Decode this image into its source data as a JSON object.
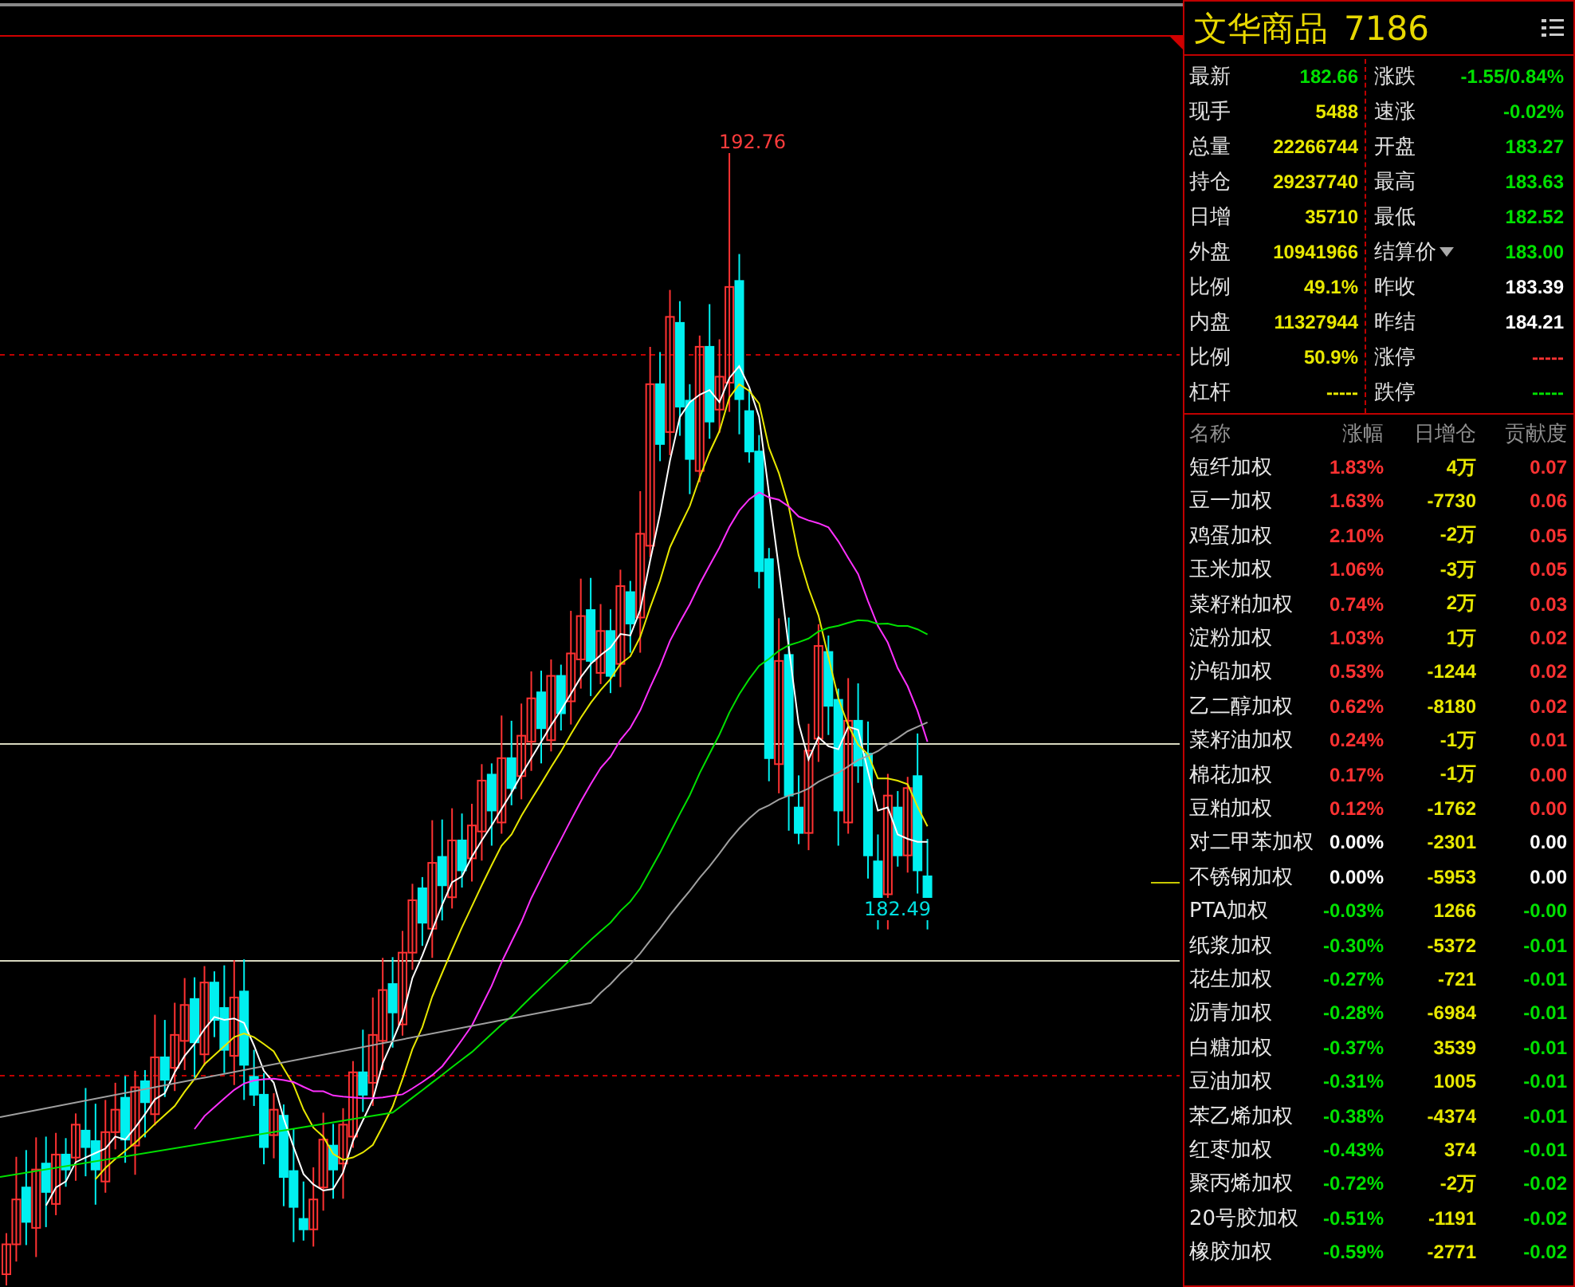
{
  "chart": {
    "high_label": "192.76",
    "low_label": "182.49"
  },
  "instrument": {
    "name": "文华商品",
    "code": "7186"
  },
  "quote": {
    "left": [
      {
        "label": "最新",
        "value": "182.66",
        "color": "#00e000"
      },
      {
        "label": "现手",
        "value": "5488",
        "color": "#e8e800"
      },
      {
        "label": "总量",
        "value": "22266744",
        "color": "#e8e800"
      },
      {
        "label": "持仓",
        "value": "29237740",
        "color": "#e8e800"
      },
      {
        "label": "日增",
        "value": "35710",
        "color": "#e8e800"
      },
      {
        "label": "外盘",
        "value": "10941966",
        "color": "#e8e800"
      },
      {
        "label": "比例",
        "value": "49.1%",
        "color": "#e8e800"
      },
      {
        "label": "内盘",
        "value": "11327944",
        "color": "#e8e800"
      },
      {
        "label": "比例",
        "value": "50.9%",
        "color": "#e8e800"
      },
      {
        "label": "杠杆",
        "value": "-----",
        "color": "#e8e800"
      }
    ],
    "right": [
      {
        "label": "涨跌",
        "value": "-1.55/0.84%",
        "color": "#00e000",
        "dropdown": false
      },
      {
        "label": "速涨",
        "value": "-0.02%",
        "color": "#00e000",
        "dropdown": false
      },
      {
        "label": "开盘",
        "value": "183.27",
        "color": "#00e000",
        "dropdown": false
      },
      {
        "label": "最高",
        "value": "183.63",
        "color": "#00e000",
        "dropdown": false
      },
      {
        "label": "最低",
        "value": "182.52",
        "color": "#00e000",
        "dropdown": false
      },
      {
        "label": "结算价",
        "value": "183.00",
        "color": "#00e000",
        "dropdown": true
      },
      {
        "label": "昨收",
        "value": "183.39",
        "color": "#ffffff",
        "dropdown": false
      },
      {
        "label": "昨结",
        "value": "184.21",
        "color": "#ffffff",
        "dropdown": false
      },
      {
        "label": "涨停",
        "value": "-----",
        "color": "#ff3232",
        "dropdown": false
      },
      {
        "label": "跌停",
        "value": "-----",
        "color": "#00e000",
        "dropdown": false
      }
    ]
  },
  "components": {
    "columns": [
      "名称",
      "涨幅",
      "日增仓",
      "贡献度"
    ],
    "rows": [
      {
        "name": "短纤加权",
        "change": "1.83%",
        "oi_change": "4万",
        "contribution": "0.07",
        "color": "#ff3232"
      },
      {
        "name": "豆一加权",
        "change": "1.63%",
        "oi_change": "-7730",
        "contribution": "0.06",
        "color": "#ff3232"
      },
      {
        "name": "鸡蛋加权",
        "change": "2.10%",
        "oi_change": "-2万",
        "contribution": "0.05",
        "color": "#ff3232"
      },
      {
        "name": "玉米加权",
        "change": "1.06%",
        "oi_change": "-3万",
        "contribution": "0.05",
        "color": "#ff3232"
      },
      {
        "name": "菜籽粕加权",
        "change": "0.74%",
        "oi_change": "2万",
        "contribution": "0.03",
        "color": "#ff3232"
      },
      {
        "name": "淀粉加权",
        "change": "1.03%",
        "oi_change": "1万",
        "contribution": "0.02",
        "color": "#ff3232"
      },
      {
        "name": "沪铅加权",
        "change": "0.53%",
        "oi_change": "-1244",
        "contribution": "0.02",
        "color": "#ff3232"
      },
      {
        "name": "乙二醇加权",
        "change": "0.62%",
        "oi_change": "-8180",
        "contribution": "0.02",
        "color": "#ff3232"
      },
      {
        "name": "菜籽油加权",
        "change": "0.24%",
        "oi_change": "-1万",
        "contribution": "0.01",
        "color": "#ff3232"
      },
      {
        "name": "棉花加权",
        "change": "0.17%",
        "oi_change": "-1万",
        "contribution": "0.00",
        "color": "#ff3232"
      },
      {
        "name": "豆粕加权",
        "change": "0.12%",
        "oi_change": "-1762",
        "contribution": "0.00",
        "color": "#ff3232"
      },
      {
        "name": "对二甲苯加权",
        "change": "0.00%",
        "oi_change": "-2301",
        "contribution": "0.00",
        "color": "#ffffff"
      },
      {
        "name": "不锈钢加权",
        "change": "0.00%",
        "oi_change": "-5953",
        "contribution": "0.00",
        "color": "#ffffff"
      },
      {
        "name": "PTA加权",
        "change": "-0.03%",
        "oi_change": "1266",
        "contribution": "-0.00",
        "color": "#00e000"
      },
      {
        "name": "纸浆加权",
        "change": "-0.30%",
        "oi_change": "-5372",
        "contribution": "-0.01",
        "color": "#00e000"
      },
      {
        "name": "花生加权",
        "change": "-0.27%",
        "oi_change": "-721",
        "contribution": "-0.01",
        "color": "#00e000"
      },
      {
        "name": "沥青加权",
        "change": "-0.28%",
        "oi_change": "-6984",
        "contribution": "-0.01",
        "color": "#00e000"
      },
      {
        "name": "白糖加权",
        "change": "-0.37%",
        "oi_change": "3539",
        "contribution": "-0.01",
        "color": "#00e000"
      },
      {
        "name": "豆油加权",
        "change": "-0.31%",
        "oi_change": "1005",
        "contribution": "-0.01",
        "color": "#00e000"
      },
      {
        "name": "苯乙烯加权",
        "change": "-0.38%",
        "oi_change": "-4374",
        "contribution": "-0.01",
        "color": "#00e000"
      },
      {
        "name": "红枣加权",
        "change": "-0.43%",
        "oi_change": "374",
        "contribution": "-0.01",
        "color": "#00e000"
      },
      {
        "name": "聚丙烯加权",
        "change": "-0.72%",
        "oi_change": "-2万",
        "contribution": "-0.02",
        "color": "#00e000"
      },
      {
        "name": "20号胶加权",
        "change": "-0.51%",
        "oi_change": "-1191",
        "contribution": "-0.02",
        "color": "#00e000"
      },
      {
        "name": "橡胶加权",
        "change": "-0.59%",
        "oi_change": "-2771",
        "contribution": "-0.02",
        "color": "#00e000"
      }
    ]
  }
}
